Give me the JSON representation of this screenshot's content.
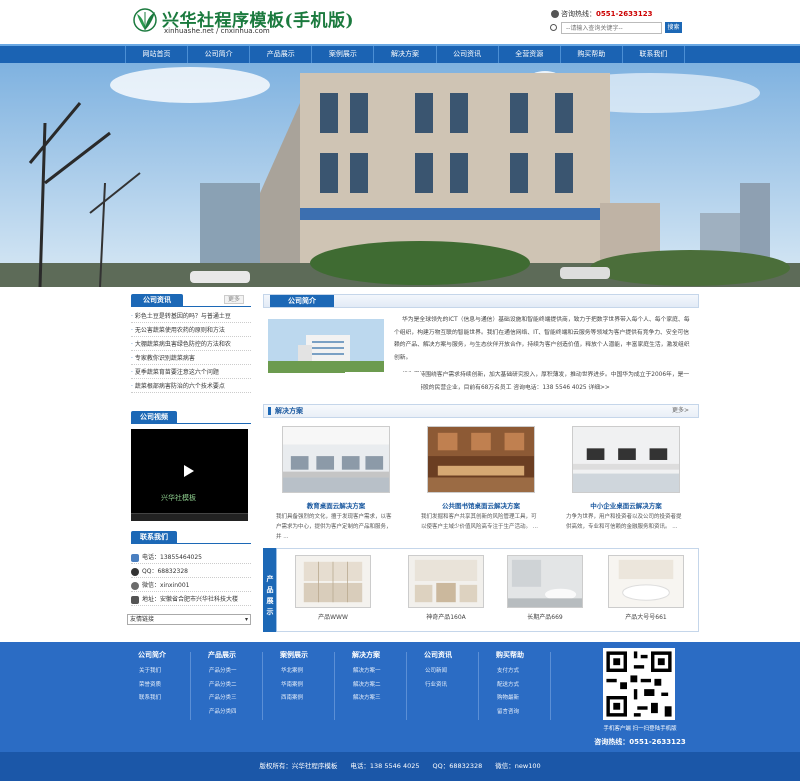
{
  "header": {
    "title": "兴华社程序模板(手机版)",
    "subtitle": "xinhuashe.net / cnxinhua.com",
    "hotline_label": "咨询热线：",
    "hotline_number": "0551-2633123",
    "search_placeholder": "--请输入查询关键字--",
    "search_button": "搜索"
  },
  "nav": [
    "网站首页",
    "公司简介",
    "产品展示",
    "案例展示",
    "解决方案",
    "公司资讯",
    "全营资源",
    "购买帮助",
    "联系我们"
  ],
  "sidebar": {
    "news_title": "公司资讯",
    "news_more": "更多",
    "news": [
      "彩色土豆是转基因的吗？与普通土豆",
      "无公害蔬菜使用农药的原则和方法",
      "大棚蔬菜病虫害绿色防控的方法和农",
      "专家教你识别蔬菜病害",
      "夏季蔬菜育苗要注意这六个问题",
      "蔬菜根部病害防治的六个技术要点"
    ],
    "video_title": "公司视频",
    "video_watermark": "兴华社模板",
    "contact_title": "联系我们",
    "contacts": [
      {
        "icon": "phone-icon",
        "text": "电话：13855464025"
      },
      {
        "icon": "qq-icon",
        "text": "QQ：68832328"
      },
      {
        "icon": "wechat-icon",
        "text": "微信：xinxin001"
      },
      {
        "icon": "location-icon",
        "text": "地址：安徽省合肥市兴华社科技大楼"
      }
    ],
    "links_select": "友情链接"
  },
  "about": {
    "title": "公司简介",
    "text1": "华为是全球领先的ICT（信息与通信）基础设施和智能终端提供商，致力于把数字世界带入每个人、每个家庭、每个组织，构建万物互联的智能世界。我们在通信网络、IT、智能终端和云服务等领域为客户提供有竞争力、安全可信赖的产品、解决方案与服务，与生态伙伴开放合作，持续为客户创造价值，释放个人潜能，丰富家庭生活，激发组织创新。",
    "text2": "华为坚持围绕客户需求持续创新，加大基础研究投入，厚积薄发，推动世界进步。中国华为成立于2006年，是一家由员工持股的民营企业，目前有68万名员工 咨询电话：138 5546 4025 详细>>",
    "badge": "华为官网"
  },
  "solutions": {
    "title": "解决方案",
    "more": "更多>",
    "items": [
      {
        "name": "教育桌面云解决方案",
        "desc": "我们具备强烈的文化，擅于发现客户需求，以客户需求为中心，提供为客户定制的产品和服务，并 ..."
      },
      {
        "name": "公共图书馆桌面云解决方案",
        "desc": "我们发掘和客户共享其创新的风险管理工具，可以使客户主域少价值风险高专注于生产活动。 ..."
      },
      {
        "name": "中小企业桌面云解决方案",
        "desc": "力争为世界，用户和投资者以及公司的投资者提供高效，专业和可信赖的金融服务和资讯。 ..."
      }
    ]
  },
  "products": {
    "label": "产品展示",
    "items": [
      "产品WWW",
      "神奇产品160A",
      "长期产品669",
      "产品大号号661"
    ]
  },
  "footer": {
    "columns": [
      {
        "title": "公司简介",
        "links": [
          "关于我们",
          "荣誉资质",
          "联系我们"
        ]
      },
      {
        "title": "产品展示",
        "links": [
          "产品分类一",
          "产品分类二",
          "产品分类三",
          "产品分类四"
        ]
      },
      {
        "title": "案例展示",
        "links": [
          "华北案例",
          "华南案例",
          "西南案例"
        ]
      },
      {
        "title": "解决方案",
        "links": [
          "解决方案一",
          "解决方案二",
          "解决方案三"
        ]
      },
      {
        "title": "公司资讯",
        "links": [
          "公司新闻",
          "行业资讯"
        ]
      },
      {
        "title": "购买帮助",
        "links": [
          "支付方式",
          "配送方式",
          "购物最新",
          "留言咨询"
        ]
      }
    ],
    "qr_caption": "手机客户端 扫一扫登陆手机版",
    "qr_tel": "咨询热线：0551-2633123",
    "copyright": "版权所有：兴华社程序模板　　电话：138 5546 4025　　QQ：68832328　　微信：new100"
  },
  "colors": {
    "brand": "#1c68b6",
    "footer": "#2b6cc4",
    "logo_green": "#1b7a3e"
  }
}
